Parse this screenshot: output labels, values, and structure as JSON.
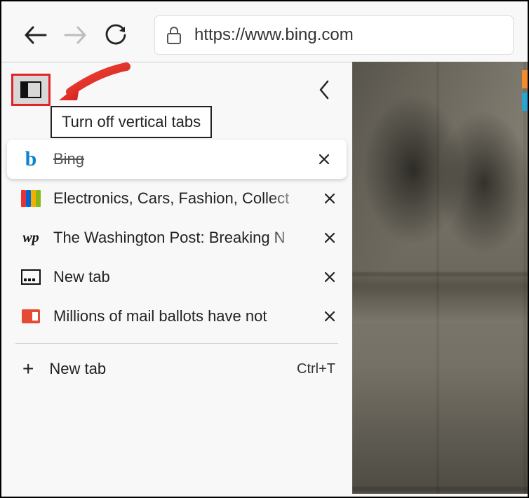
{
  "toolbar": {
    "url": "https://www.bing.com"
  },
  "sidebar": {
    "tooltip": "Turn off vertical tabs",
    "tabs": [
      {
        "title": "Bing",
        "favicon": "bing",
        "active": true
      },
      {
        "title": "Electronics, Cars, Fashion, Collect",
        "favicon": "ebay",
        "active": false
      },
      {
        "title": "The Washington Post: Breaking N",
        "favicon": "wp",
        "active": false
      },
      {
        "title": "New tab",
        "favicon": "newtab",
        "active": false
      },
      {
        "title": "Millions of mail ballots have not ",
        "favicon": "red",
        "active": false
      }
    ],
    "new_tab_label": "New tab",
    "new_tab_shortcut": "Ctrl+T"
  },
  "colors": {
    "highlight": "#e0252a",
    "arrow": "#e8332d",
    "ebay": [
      "#e53238",
      "#0064d2",
      "#f5af02",
      "#86b817"
    ]
  }
}
